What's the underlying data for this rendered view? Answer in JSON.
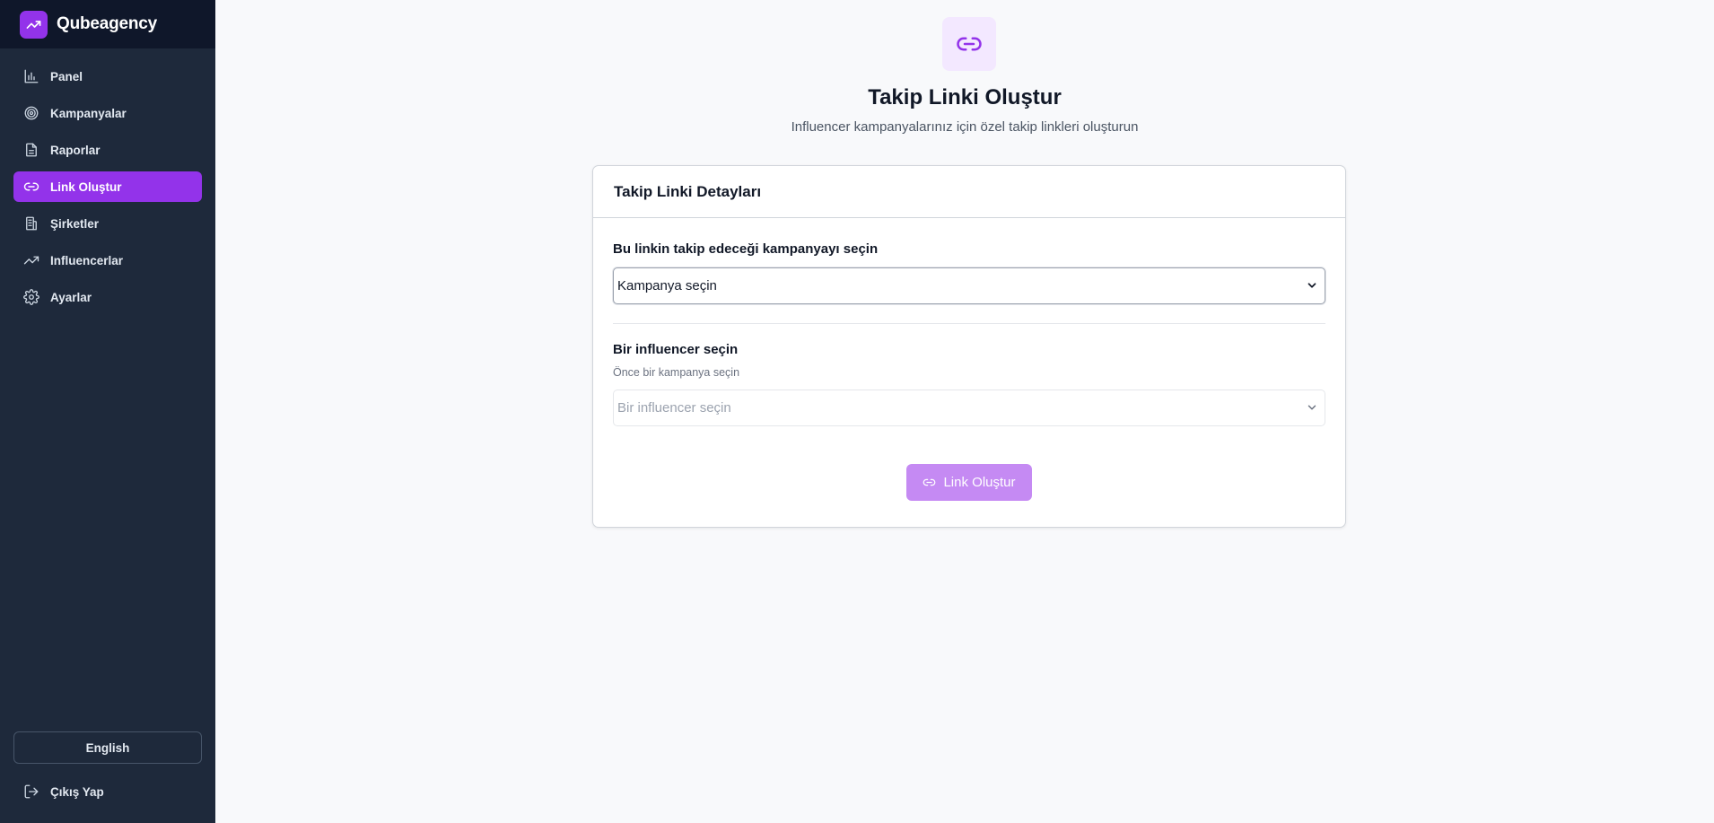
{
  "app": {
    "brand_name": "Qubeagency",
    "brand_icon": "trending-up-icon",
    "accent_color": "#9333ea"
  },
  "sidebar": {
    "items": [
      {
        "label": "Panel",
        "icon": "bar-chart-icon",
        "active": false
      },
      {
        "label": "Kampanyalar",
        "icon": "target-icon",
        "active": false
      },
      {
        "label": "Raporlar",
        "icon": "file-text-icon",
        "active": false
      },
      {
        "label": "Link Oluştur",
        "icon": "link-icon",
        "active": true
      },
      {
        "label": "Şirketler",
        "icon": "building-icon",
        "active": false
      },
      {
        "label": "Influencerlar",
        "icon": "trending-up-icon",
        "active": false
      },
      {
        "label": "Ayarlar",
        "icon": "gear-icon",
        "active": false
      }
    ],
    "language_button": "English",
    "logout_label": "Çıkış Yap"
  },
  "page": {
    "title": "Takip Linki Oluştur",
    "subtitle": "Influencer kampanyalarınız için özel takip linkleri oluşturun",
    "header_icon": "link-icon"
  },
  "form": {
    "card_title": "Takip Linki Detayları",
    "campaign_label": "Bu linkin takip edeceği kampanyayı seçin",
    "campaign_value": "Kampanya seçin",
    "influencer_label": "Bir influencer seçin",
    "influencer_hint": "Önce bir kampanya seçin",
    "influencer_placeholder": "Bir influencer seçin",
    "submit_label": "Link Oluştur"
  }
}
